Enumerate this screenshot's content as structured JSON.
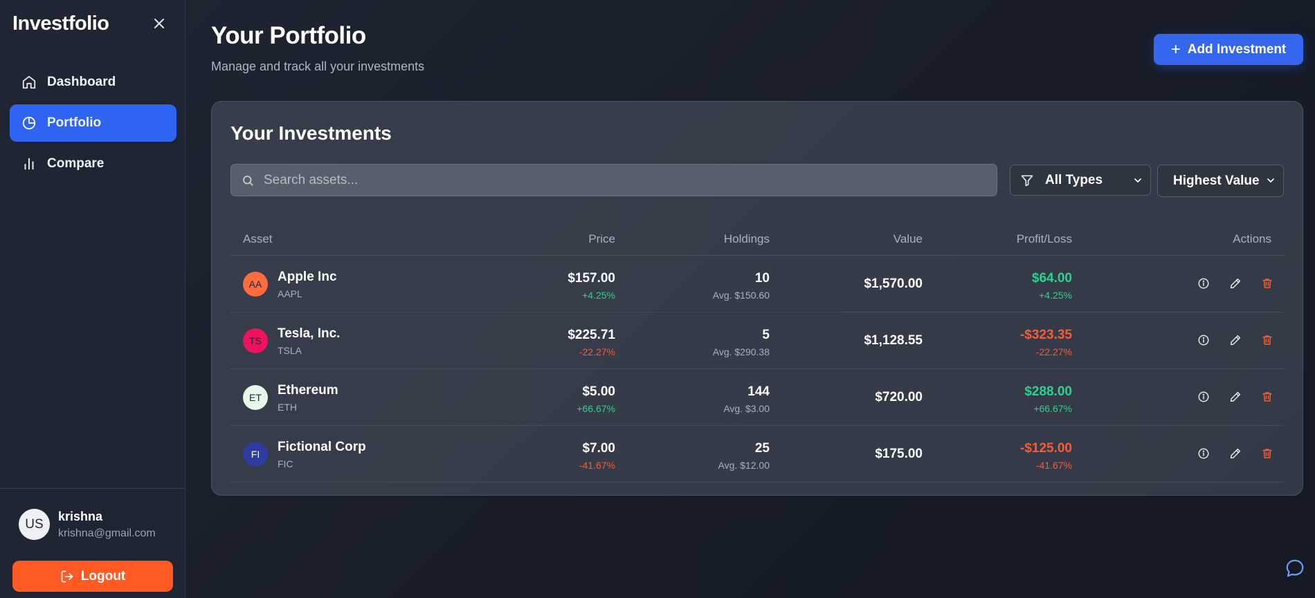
{
  "sidebar": {
    "brand": "Investfolio",
    "nav": [
      {
        "label": "Dashboard",
        "icon": "home-icon",
        "active": false
      },
      {
        "label": "Portfolio",
        "icon": "pie-chart-icon",
        "active": true
      },
      {
        "label": "Compare",
        "icon": "bar-chart-icon",
        "active": false
      }
    ],
    "user": {
      "initials": "US",
      "name": "krishna",
      "email": "krishna@gmail.com"
    },
    "logout_label": "Logout"
  },
  "header": {
    "title": "Your Portfolio",
    "subtitle": "Manage and track all your investments",
    "add_label": "Add Investment"
  },
  "investments": {
    "title": "Your Investments",
    "search_placeholder": "Search assets...",
    "type_filter": "All Types",
    "sort": "Highest Value",
    "columns": [
      "Asset",
      "Price",
      "Holdings",
      "Value",
      "Profit/Loss",
      "Actions"
    ],
    "rows": [
      {
        "initials": "AA",
        "avatar_bg": "#ff6b3d",
        "avatar_fg": "#1f2533",
        "name": "Apple Inc",
        "symbol": "AAPL",
        "price": "$157.00",
        "price_change": "+4.25%",
        "price_trend": "pos",
        "holdings": "10",
        "avg": "Avg. $150.60",
        "value": "$1,570.00",
        "pl": "$64.00",
        "pl_pct": "+4.25%",
        "pl_trend": "pos"
      },
      {
        "initials": "TS",
        "avatar_bg": "#f0125c",
        "avatar_fg": "#1f2533",
        "name": "Tesla, Inc.",
        "symbol": "TSLA",
        "price": "$225.71",
        "price_change": "-22.27%",
        "price_trend": "neg",
        "holdings": "5",
        "avg": "Avg. $290.38",
        "value": "$1,128.55",
        "pl": "-$323.35",
        "pl_pct": "-22.27%",
        "pl_trend": "neg"
      },
      {
        "initials": "ET",
        "avatar_bg": "#e8f5e9",
        "avatar_fg": "#1f2533",
        "name": "Ethereum",
        "symbol": "ETH",
        "price": "$5.00",
        "price_change": "+66.67%",
        "price_trend": "pos",
        "holdings": "144",
        "avg": "Avg. $3.00",
        "value": "$720.00",
        "pl": "$288.00",
        "pl_pct": "+66.67%",
        "pl_trend": "pos"
      },
      {
        "initials": "FI",
        "avatar_bg": "#2f3c9f",
        "avatar_fg": "#ffffff",
        "name": "Fictional Corp",
        "symbol": "FIC",
        "price": "$7.00",
        "price_change": "-41.67%",
        "price_trend": "neg",
        "holdings": "25",
        "avg": "Avg. $12.00",
        "value": "$175.00",
        "pl": "-$125.00",
        "pl_pct": "-41.67%",
        "pl_trend": "neg"
      }
    ]
  },
  "colors": {
    "accent": "#2f63f2",
    "logout": "#ff5a24",
    "positive": "#2bd48c",
    "negative": "#ff5a2d"
  }
}
